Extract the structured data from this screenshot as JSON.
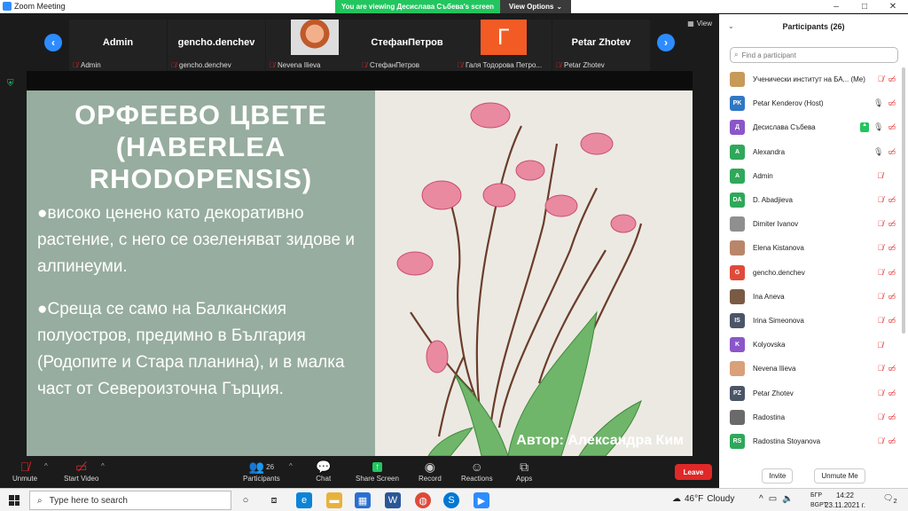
{
  "window": {
    "title": "Zoom Meeting"
  },
  "banner": {
    "message": "You are viewing Десислава Събева's screen",
    "options": "View Options"
  },
  "window_controls": {
    "minimize": "–",
    "maximize": "□",
    "close": "✕"
  },
  "stage": {
    "view_label": "View",
    "thumbnails": [
      {
        "display": "Admin",
        "name": "Admin"
      },
      {
        "display": "gencho.denchev",
        "name": "gencho.denchev"
      },
      {
        "display": "",
        "name": "Nevena Ilieva"
      },
      {
        "display": "СтефанПетров",
        "name": "СтефанПетров"
      },
      {
        "display": "Г",
        "name": "Галя Тодорова Петро..."
      },
      {
        "display": "Petar Zhotev",
        "name": "Petar Zhotev"
      }
    ]
  },
  "slide": {
    "title": "ОРФЕЕВО ЦВЕТЕ (HABERLEA RHODOPENSIS)",
    "p1": "●високо ценено като декоративно растение, с него се озеленяват зидове и алпинеуми.",
    "p2": "●Среща се само на Балканския полуостров, предимно в България (Родопите и Стара планина), и в малка част от Североизточна Гърция.",
    "credit": "Автор: Александра Ким",
    "colors": {
      "text_bg": "#97ad9f",
      "image_bg": "#ece9e3",
      "petal": "#e98aa0",
      "stem": "#6b3d2a",
      "leaf": "#6fb56a"
    }
  },
  "toolbar": {
    "unmute": "Unmute",
    "start_video": "Start Video",
    "participants": "Participants",
    "participants_count": "26",
    "chat": "Chat",
    "share": "Share Screen",
    "record": "Record",
    "reactions": "Reactions",
    "apps": "Apps",
    "leave": "Leave"
  },
  "panel": {
    "title": "Participants (26)",
    "search_placeholder": "Find a participant",
    "invite": "Invite",
    "unmute_me": "Unmute Me",
    "participants": [
      {
        "initials": "",
        "color": "#c79a5a",
        "name": "Ученически институт на БА... (Me)",
        "mic": "muted",
        "video": "off",
        "share": false
      },
      {
        "initials": "PK",
        "color": "#2f78c4",
        "name": "Petar Kenderov (Host)",
        "mic": "on",
        "video": "off",
        "share": false
      },
      {
        "initials": "Д",
        "color": "#8b56c9",
        "name": "Десислава Събева",
        "mic": "on",
        "video": "off",
        "share": true
      },
      {
        "initials": "A",
        "color": "#2fa85a",
        "name": "Alexandra",
        "mic": "on",
        "video": "off",
        "share": false
      },
      {
        "initials": "A",
        "color": "#2fa85a",
        "name": "Admin",
        "mic": "muted",
        "video": "none",
        "share": false
      },
      {
        "initials": "DA",
        "color": "#2fa85a",
        "name": "D. Abadjieva",
        "mic": "muted",
        "video": "off",
        "share": false
      },
      {
        "initials": "",
        "color": "#8f8f8f",
        "name": "Dimiter Ivanov",
        "mic": "muted",
        "video": "off",
        "share": false
      },
      {
        "initials": "",
        "color": "#b9866a",
        "name": "Elena Kistanova",
        "mic": "muted",
        "video": "off",
        "share": false
      },
      {
        "initials": "G",
        "color": "#e04a3a",
        "name": "gencho.denchev",
        "mic": "muted",
        "video": "off",
        "share": false
      },
      {
        "initials": "",
        "color": "#7a5a44",
        "name": "Ina Aneva",
        "mic": "muted",
        "video": "off",
        "share": false
      },
      {
        "initials": "IS",
        "color": "#4a5568",
        "name": "Irina Simeonova",
        "mic": "muted",
        "video": "off",
        "share": false
      },
      {
        "initials": "K",
        "color": "#8b56c9",
        "name": "Kolyovska",
        "mic": "muted",
        "video": "none",
        "share": false
      },
      {
        "initials": "",
        "color": "#d9a07a",
        "name": "Nevena Ilieva",
        "mic": "muted",
        "video": "off",
        "share": false
      },
      {
        "initials": "PZ",
        "color": "#4a5568",
        "name": "Petar Zhotev",
        "mic": "muted",
        "video": "off",
        "share": false
      },
      {
        "initials": "",
        "color": "#6a6a6a",
        "name": "Radostina",
        "mic": "muted",
        "video": "off",
        "share": false
      },
      {
        "initials": "RS",
        "color": "#2fa85a",
        "name": "Radostina Stoyanova",
        "mic": "muted",
        "video": "off",
        "share": false
      }
    ]
  },
  "taskbar": {
    "search": "Type here to search",
    "weather_temp": "46°F",
    "weather_desc": "Cloudy",
    "lang1": "БГР",
    "lang2": "BGPT",
    "time": "14:22",
    "date": "23.11.2021 г.",
    "notifications": "2"
  }
}
